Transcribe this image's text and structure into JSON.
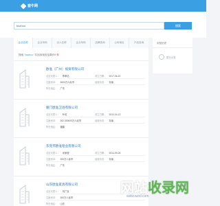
{
  "header": {
    "logo_text": "套牛网"
  },
  "search": {
    "query": "bazhuo",
    "button_label": "搜索"
  },
  "tabs": [
    {
      "label": "企业名称",
      "active": true
    },
    {
      "label": "企业号码",
      "active": false
    },
    {
      "label": "法人名称",
      "active": false
    },
    {
      "label": "企业号码",
      "active": false
    },
    {
      "label": "品牌查询",
      "active": false
    },
    {
      "label": "公司地址",
      "active": false
    },
    {
      "label": "产品查询",
      "active": false
    }
  ],
  "results": {
    "prefix": "搜索 \"",
    "query": "bazhuo",
    "middle": "\" 共找到相关结果约",
    "count": "9",
    "suffix": " 条",
    "items": [
      {
        "name": "欧准（广州）投资有限公司",
        "legal_label": "法定代表人：",
        "legal": "李孝志",
        "date_label": "成立日期：",
        "date": "2017-06-22",
        "capital_label": "注册资本：",
        "capital": "3000万人民币",
        "status_label": "经营状态：",
        "status": "存续",
        "region_label": "所在地区：",
        "region": "广东"
      },
      {
        "name": "厦门欧准卫浴有限公司",
        "legal_label": "法定代表人：",
        "legal": "叶虹",
        "date_label": "成立日期：",
        "date": "2010-04-13",
        "capital_label": "注册资本：",
        "capital": "302.300000万人民币",
        "status_label": "经营状态：",
        "status": "存续",
        "region_label": "所在地区：",
        "region": "福建"
      },
      {
        "name": "东莞市欧准铝业有限公司",
        "legal_label": "法定代表人：",
        "legal": "米家营",
        "date_label": "成立日期：",
        "date": "2014-09-26",
        "capital_label": "注册资本：",
        "capital": "300万人民币",
        "status_label": "经营状态：",
        "status": "存续",
        "region_label": "所在地区：",
        "region": "广东"
      },
      {
        "name": "山东欧准家具有限公司",
        "legal_label": "法定代表人：",
        "legal": "刘广民",
        "date_label": "成立日期：",
        "date": "",
        "capital_label": "注册资本：",
        "capital": "300万人民币",
        "status_label": "经营状态：",
        "status": "",
        "region_label": "所在地区：",
        "region": "山东"
      }
    ]
  },
  "sidebar": {
    "title": "浏览历史",
    "empty_text": "暂无记录"
  },
  "watermark": {
    "text_a": "网站",
    "text_b": "收录网",
    "url": "www.wzsl.com"
  },
  "colors": {
    "brand": "#3a9fe3",
    "link": "#2a78c2",
    "count": "#e95050"
  }
}
